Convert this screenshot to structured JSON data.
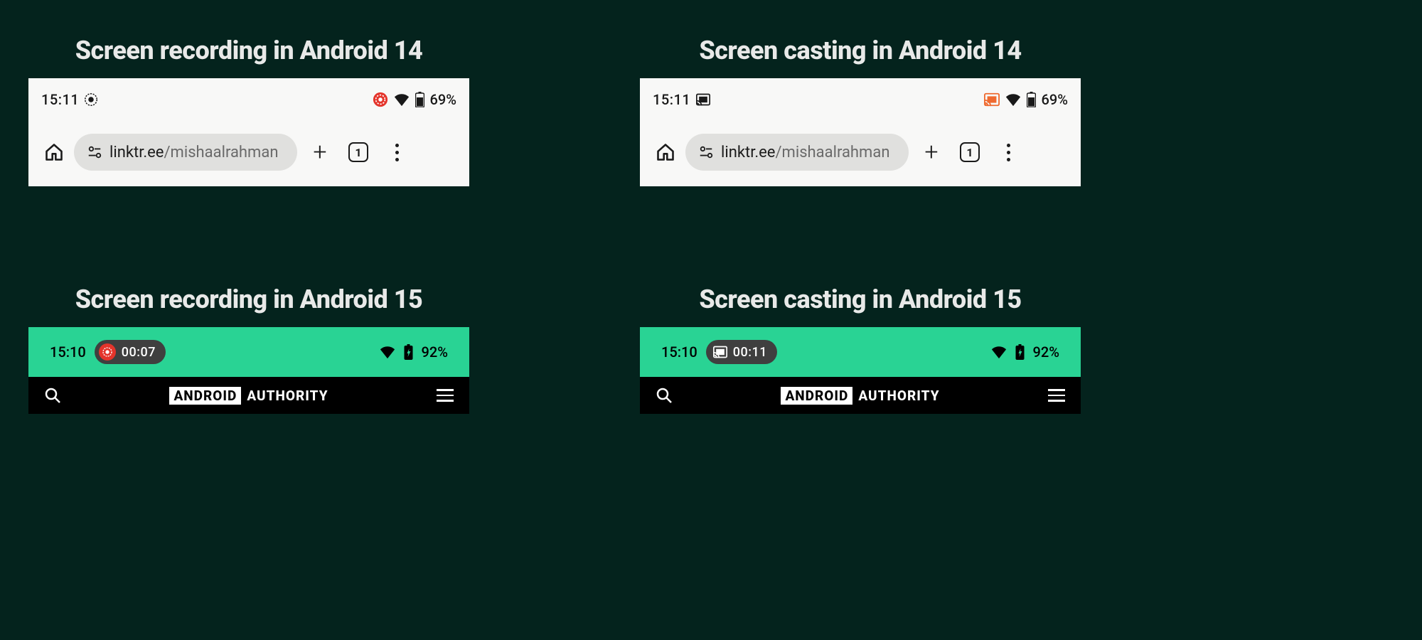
{
  "panels": {
    "rec14": {
      "title": "Screen recording in Android 14",
      "time": "15:11",
      "battery": "69%",
      "url_host": "linktr.ee",
      "url_path": "/mishaalrahman",
      "tab_count": "1"
    },
    "cast14": {
      "title": "Screen casting in Android 14",
      "time": "15:11",
      "battery": "69%",
      "url_host": "linktr.ee",
      "url_path": "/mishaalrahman",
      "tab_count": "1"
    },
    "rec15": {
      "title": "Screen recording in Android 15",
      "time": "15:10",
      "chip_time": "00:07",
      "battery": "92%",
      "brand_box": "ANDROID",
      "brand_text": "AUTHORITY"
    },
    "cast15": {
      "title": "Screen casting in Android 15",
      "time": "15:10",
      "chip_time": "00:11",
      "battery": "92%",
      "brand_box": "ANDROID",
      "brand_text": "AUTHORITY"
    }
  },
  "colors": {
    "bg": "#04231d",
    "a15_status": "#29d394",
    "record_red": "#e4342b",
    "cast_orange": "#ef6a2f"
  }
}
